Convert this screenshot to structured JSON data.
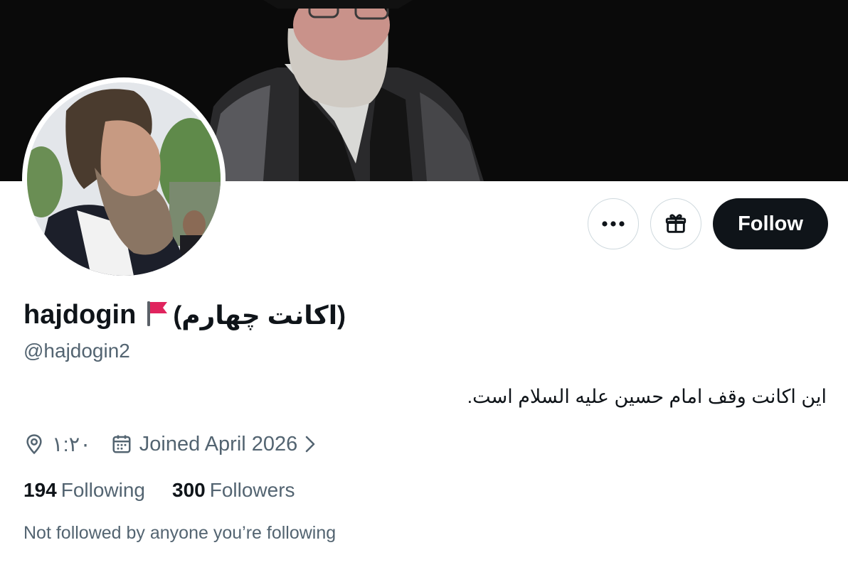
{
  "profile": {
    "display_name": "hajdogin",
    "display_suffix": "(اکانت چهارم)",
    "handle": "@hajdogin2",
    "bio": "این اکانت وقف امام حسین علیه السلام است.",
    "location": "۱:۲۰",
    "joined": "Joined April 2026",
    "following_count": "194",
    "following_label": "Following",
    "followers_count": "300",
    "followers_label": "Followers",
    "not_followed_text": "Not followed by anyone you’re following"
  },
  "actions": {
    "follow_label": "Follow",
    "more_icon": "more-icon",
    "gift_icon": "gift-icon"
  },
  "colors": {
    "primary_text": "#0f1419",
    "secondary_text": "#536471",
    "follow_bg": "#0f1419",
    "border": "#cfd9de",
    "flag": "#e0245e"
  }
}
